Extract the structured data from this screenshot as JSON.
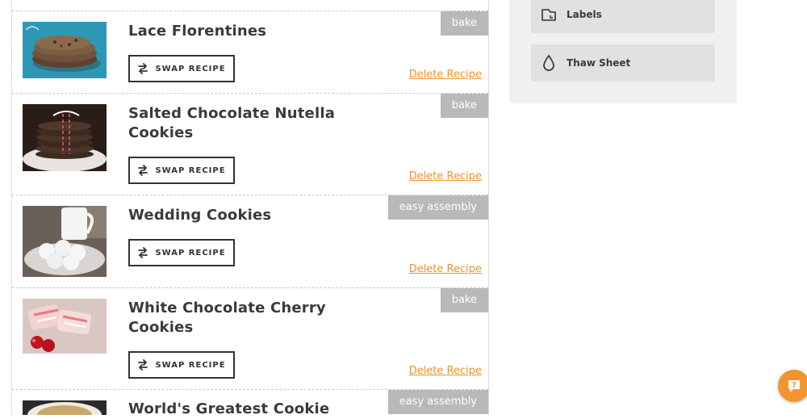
{
  "recipes": [
    {
      "title": "Lace Florentines",
      "tag": "bake",
      "swap_label": "SWAP RECIPE",
      "delete_label": "Delete Recipe",
      "thumb_icon": "cookie-photo"
    },
    {
      "title": "Salted Chocolate Nutella Cookies",
      "tag": "bake",
      "swap_label": "SWAP RECIPE",
      "delete_label": "Delete Recipe",
      "thumb_icon": "cookie-photo"
    },
    {
      "title": "Wedding Cookies",
      "tag": "easy assembly",
      "swap_label": "SWAP RECIPE",
      "delete_label": "Delete Recipe",
      "thumb_icon": "cookie-photo"
    },
    {
      "title": "White Chocolate Cherry Cookies",
      "tag": "bake",
      "swap_label": "SWAP RECIPE",
      "delete_label": "Delete Recipe",
      "thumb_icon": "cookie-photo"
    },
    {
      "title": "World's Greatest Cookie",
      "tag": "easy assembly",
      "thumb_icon": "cookie-photo"
    }
  ],
  "sidebar": {
    "labels_button": "Labels",
    "thaw_button": "Thaw Sheet",
    "labels_icon": "label-icon",
    "thaw_icon": "drop-icon"
  },
  "help": {
    "icon": "help-chat-icon"
  },
  "colors": {
    "accent": "#f0902a",
    "tag_bg": "#b9b9b9",
    "help_bg": "#f3952d",
    "sidebar_bg": "#f0f0f0",
    "sidebar_button_bg": "#e1e1e1"
  }
}
